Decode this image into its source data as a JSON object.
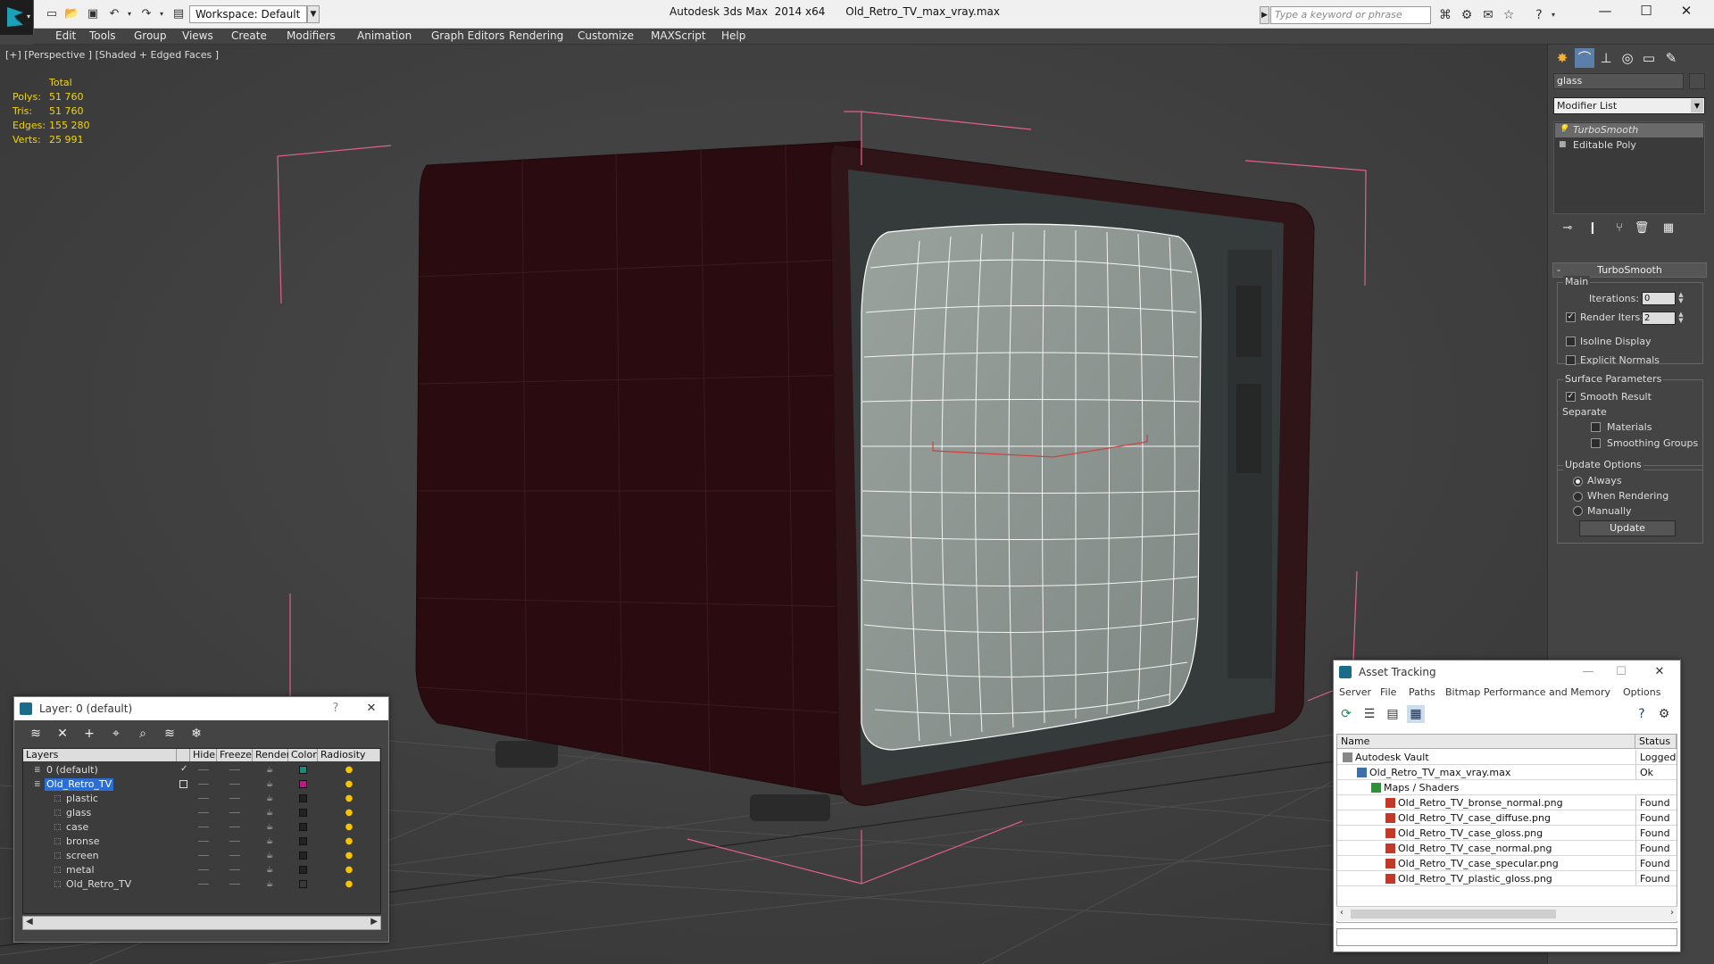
{
  "titlebar": {
    "workspace": "Workspace: Default",
    "app_title": "Autodesk 3ds Max  2014 x64",
    "file_name": "Old_Retro_TV_max_vray.max",
    "search_placeholder": "Type a keyword or phrase"
  },
  "menu": [
    "Edit",
    "Tools",
    "Group",
    "Views",
    "Create",
    "Modifiers",
    "Animation",
    "Graph Editors",
    "Rendering",
    "Customize",
    "MAXScript",
    "Help"
  ],
  "viewport": {
    "label": "[+] [Perspective ] [Shaded + Edged Faces ]",
    "stats_header": "Total",
    "stats": [
      {
        "k": "Polys:",
        "v": "51 760"
      },
      {
        "k": "Tris:",
        "v": "51 760"
      },
      {
        "k": "Edges:",
        "v": "155 280"
      },
      {
        "k": "Verts:",
        "v": "25 991"
      }
    ]
  },
  "command_panel": {
    "object_name": "glass",
    "modifier_list": "Modifier List",
    "stack": [
      "TurboSmooth",
      "Editable Poly"
    ],
    "rollout_title": "TurboSmooth",
    "main_group": "Main",
    "iterations_label": "Iterations:",
    "iterations_value": "0",
    "render_iters_label": "Render Iters:",
    "render_iters_value": "2",
    "isoline_label": "Isoline Display",
    "explicit_normals_label": "Explicit Normals",
    "surface_group": "Surface Parameters",
    "smooth_result_label": "Smooth Result",
    "separate_label": "Separate",
    "materials_label": "Materials",
    "smoothing_groups_label": "Smoothing Groups",
    "update_group": "Update Options",
    "always_label": "Always",
    "when_rendering_label": "When Rendering",
    "manually_label": "Manually",
    "update_button": "Update"
  },
  "layer_window": {
    "title": "Layer: 0 (default)",
    "help": "?",
    "columns": [
      "Layers",
      "Hide",
      "Freeze",
      "Render",
      "Color",
      "Radiosity"
    ],
    "rows": [
      {
        "name": "0 (default)",
        "color": "#1a8c7a"
      },
      {
        "name": "Old_Retro_TV",
        "color": "#c0178a"
      },
      {
        "name": "plastic",
        "color": "#222222"
      },
      {
        "name": "glass",
        "color": "#222222"
      },
      {
        "name": "case",
        "color": "#222222"
      },
      {
        "name": "bronse",
        "color": "#222222"
      },
      {
        "name": "screen",
        "color": "#222222"
      },
      {
        "name": "metal",
        "color": "#222222"
      },
      {
        "name": "Old_Retro_TV",
        "color": "#3a3a3a"
      }
    ]
  },
  "asset_window": {
    "title": "Asset Tracking",
    "menu": [
      "Server",
      "File",
      "Paths",
      "Bitmap Performance and Memory",
      "Options"
    ],
    "col_name": "Name",
    "col_status": "Status",
    "rows": [
      {
        "name": "Autodesk Vault",
        "status": "Logged Out"
      },
      {
        "name": "Old_Retro_TV_max_vray.max",
        "status": "Ok"
      },
      {
        "name": "Maps / Shaders",
        "status": ""
      },
      {
        "name": "Old_Retro_TV_bronse_normal.png",
        "status": "Found"
      },
      {
        "name": "Old_Retro_TV_case_diffuse.png",
        "status": "Found"
      },
      {
        "name": "Old_Retro_TV_case_gloss.png",
        "status": "Found"
      },
      {
        "name": "Old_Retro_TV_case_normal.png",
        "status": "Found"
      },
      {
        "name": "Old_Retro_TV_case_specular.png",
        "status": "Found"
      },
      {
        "name": "Old_Retro_TV_plastic_gloss.png",
        "status": "Found"
      }
    ]
  }
}
